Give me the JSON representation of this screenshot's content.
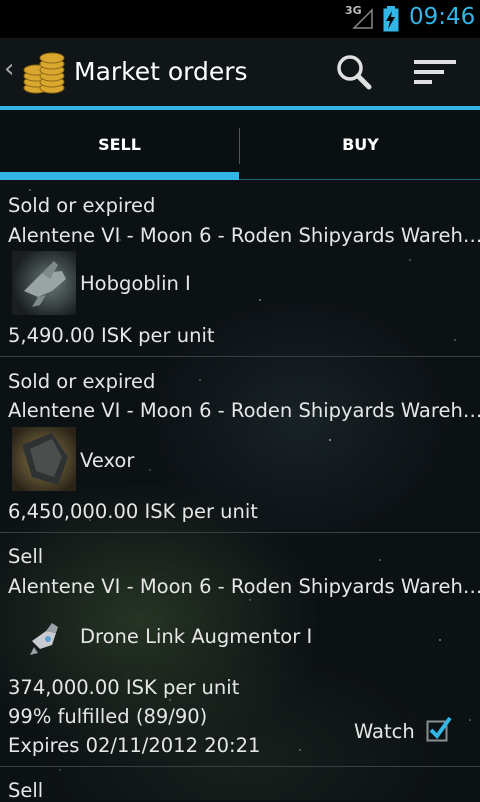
{
  "status_bar": {
    "network": "3G",
    "time": "09:46",
    "accent": "#33b5e5"
  },
  "action_bar": {
    "title": "Market orders",
    "up_icon": "chevron-left-icon",
    "logo_icon": "isk-coins-icon",
    "search_icon": "search-icon",
    "sort_icon": "sort-icon"
  },
  "tabs": [
    {
      "label": "SELL",
      "selected": true
    },
    {
      "label": "BUY",
      "selected": false
    }
  ],
  "orders": [
    {
      "status": "Sold or expired",
      "location": "Alentene VI - Moon 6 - Roden Shipyards Wareh…",
      "item": "Hobgoblin I",
      "price": "5,490.00 ISK per unit"
    },
    {
      "status": "Sold or expired",
      "location": "Alentene VI - Moon 6 - Roden Shipyards Wareh…",
      "item": "Vexor",
      "price": "6,450,000.00 ISK per unit"
    },
    {
      "status": "Sell",
      "location": "Alentene VI - Moon 6 - Roden Shipyards Wareh…",
      "item": "Drone Link Augmentor I",
      "price": "374,000.00 ISK per unit",
      "fulfilled": "99% fulfilled (89/90)",
      "expires": "Expires 02/11/2012 20:21",
      "watch_label": "Watch",
      "watch_checked": true
    },
    {
      "status": "Sell"
    }
  ]
}
